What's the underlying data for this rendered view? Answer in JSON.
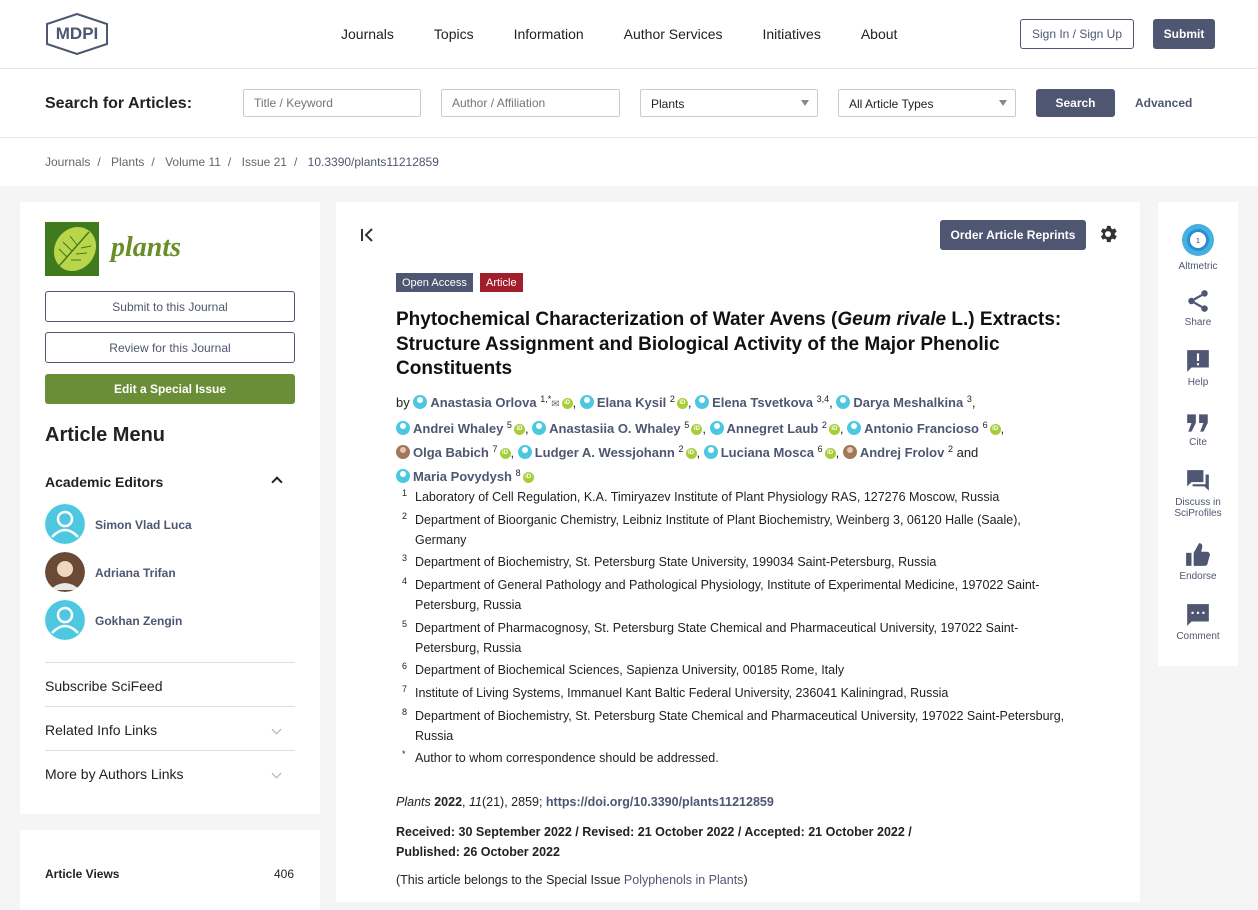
{
  "header": {
    "logo_text": "MDPI",
    "nav": [
      "Journals",
      "Topics",
      "Information",
      "Author Services",
      "Initiatives",
      "About"
    ],
    "sign_in": "Sign In / Sign Up",
    "submit": "Submit"
  },
  "search": {
    "label": "Search for Articles:",
    "title_placeholder": "Title / Keyword",
    "author_placeholder": "Author / Affiliation",
    "journal_value": "Plants",
    "type_value": "All Article Types",
    "search_button": "Search",
    "advanced": "Advanced"
  },
  "breadcrumb": [
    "Journals",
    "Plants",
    "Volume 11",
    "Issue 21",
    "10.3390/plants11212859"
  ],
  "sidebar": {
    "journal_name": "plants",
    "submit_btn": "Submit to this Journal",
    "review_btn": "Review for this Journal",
    "edit_btn": "Edit a Special Issue",
    "menu_title": "Article Menu",
    "academic_editors": "Academic Editors",
    "editors": [
      "Simon Vlad Luca",
      "Adriana Trifan",
      "Gokhan Zengin"
    ],
    "subscribe": "Subscribe SciFeed",
    "related": "Related Info Links",
    "more_authors": "More by Authors Links",
    "views_label": "Article Views",
    "views_value": "406"
  },
  "article": {
    "reprints_btn": "Order Article Reprints",
    "badge_open": "Open Access",
    "badge_type": "Article",
    "title_a": "Phytochemical Characterization of Water Avens (",
    "title_italic": "Geum rivale",
    "title_b": " L.) Extracts: Structure Assignment and Biological Activity of the Major Phenolic Constituents",
    "by": "by",
    "authors": [
      {
        "name": "Anastasia Orlova",
        "sup": "1,*"
      },
      {
        "name": "Elana Kysil",
        "sup": "2"
      },
      {
        "name": "Elena Tsvetkova",
        "sup": "3,4"
      },
      {
        "name": "Darya Meshalkina",
        "sup": "3"
      },
      {
        "name": "Andrei Whaley",
        "sup": "5"
      },
      {
        "name": "Anastasiia O. Whaley",
        "sup": "5"
      },
      {
        "name": "Annegret Laub",
        "sup": "2"
      },
      {
        "name": "Antonio Francioso",
        "sup": "6"
      },
      {
        "name": "Olga Babich",
        "sup": "7"
      },
      {
        "name": "Ludger A. Wessjohann",
        "sup": "2"
      },
      {
        "name": "Luciana Mosca",
        "sup": "6"
      },
      {
        "name": "Andrej Frolov",
        "sup": "2"
      },
      {
        "name": "Maria Povydysh",
        "sup": "8"
      }
    ],
    "and": "and",
    "affiliations": [
      {
        "n": "1",
        "t": "Laboratory of Cell Regulation, K.A. Timiryazev Institute of Plant Physiology RAS, 127276 Moscow, Russia"
      },
      {
        "n": "2",
        "t": "Department of Bioorganic Chemistry, Leibniz Institute of Plant Biochemistry, Weinberg 3, 06120 Halle (Saale), Germany"
      },
      {
        "n": "3",
        "t": "Department of Biochemistry, St. Petersburg State University, 199034 Saint-Petersburg, Russia"
      },
      {
        "n": "4",
        "t": "Department of General Pathology and Pathological Physiology, Institute of Experimental Medicine, 197022 Saint-Petersburg, Russia"
      },
      {
        "n": "5",
        "t": "Department of Pharmacognosy, St. Petersburg State Chemical and Pharmaceutical University, 197022 Saint-Petersburg, Russia"
      },
      {
        "n": "6",
        "t": "Department of Biochemical Sciences, Sapienza University, 00185 Rome, Italy"
      },
      {
        "n": "7",
        "t": "Institute of Living Systems, Immanuel Kant Baltic Federal University, 236041 Kaliningrad, Russia"
      },
      {
        "n": "8",
        "t": "Department of Biochemistry, St. Petersburg State Chemical and Pharmaceutical University, 197022 Saint-Petersburg, Russia"
      },
      {
        "n": "*",
        "t": "Author to whom correspondence should be addressed."
      }
    ],
    "cite_journal": "Plants",
    "cite_year": "2022",
    "cite_vol": "11",
    "cite_rest": "(21), 2859; ",
    "cite_doi": "https://doi.org/10.3390/plants11212859",
    "dates": "Received: 30 September 2022 / Revised: 21 October 2022 / Accepted: 21 October 2022 / Published: 26 October 2022",
    "belongs_prefix": "(This article belongs to the Special Issue ",
    "belongs_link": "Polyphenols in Plants",
    "belongs_suffix": ")"
  },
  "right_actions": [
    {
      "label": "Altmetric",
      "badge": "1"
    },
    {
      "label": "Share"
    },
    {
      "label": "Help"
    },
    {
      "label": "Cite"
    },
    {
      "label": "Discuss in SciProfiles"
    },
    {
      "label": "Endorse"
    },
    {
      "label": "Comment"
    }
  ],
  "colors": {
    "brand": "#4f5671",
    "green": "#6a8e37",
    "badge_open": "#4f5671",
    "badge_article": "#a11f2c",
    "orcid": "#a6ce39"
  }
}
